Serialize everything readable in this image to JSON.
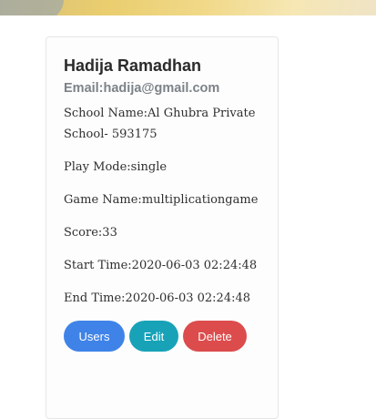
{
  "profile": {
    "name": "Hadija Ramadhan",
    "email": "Email:hadija@gmail.com",
    "school": "School Name:Al Ghubra Private School- 593175",
    "play_mode": "Play Mode:single",
    "game_name": "Game Name:multiplicationgame",
    "score": "Score:33",
    "start_time": "Start Time:2020-06-03 02:24:48",
    "end_time": "End Time:2020-06-03 02:24:48"
  },
  "actions": {
    "users_label": "Users",
    "edit_label": "Edit",
    "delete_label": "Delete"
  },
  "colors": {
    "users_button": "#3f83e8",
    "edit_button": "#17a2b8",
    "delete_button": "#dc4c4c"
  }
}
